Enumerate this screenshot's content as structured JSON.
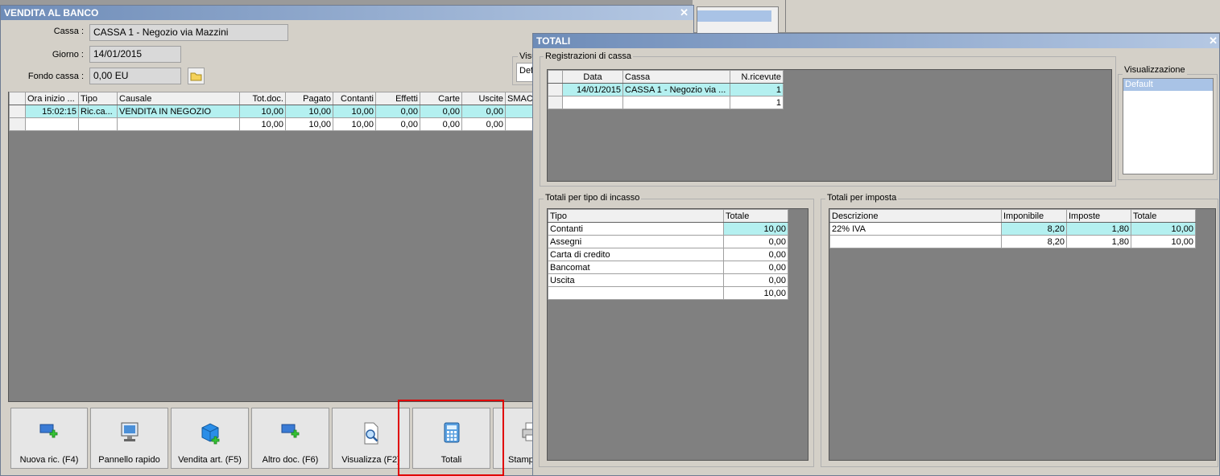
{
  "background": {
    "title_fragment": ""
  },
  "vendita": {
    "title": "VENDITA AL BANCO",
    "cassa_label": "Cassa :",
    "cassa_value": "CASSA 1 - Negozio via Mazzini",
    "giorno_label": "Giorno :",
    "giorno_value": "14/01/2015",
    "fondo_label": "Fondo cassa :",
    "fondo_value": "0,00 EU",
    "visu_label": "Visu",
    "visu_value": "Def",
    "columns": [
      "Ora inizio ...",
      "Tipo",
      "Causale",
      "Tot.doc.",
      "Pagato",
      "Contanti",
      "Effetti",
      "Carte",
      "Uscite",
      "SMAC"
    ],
    "rows": [
      [
        "15:02:15",
        "Ric.ca...",
        "VENDITA IN NEGOZIO",
        "10,00",
        "10,00",
        "10,00",
        "0,00",
        "0,00",
        "0,00",
        ""
      ],
      [
        "",
        "",
        "",
        "10,00",
        "10,00",
        "10,00",
        "0,00",
        "0,00",
        "0,00",
        ""
      ]
    ],
    "buttons": [
      "Nuova ric. (F4)",
      "Pannello rapido",
      "Vendita art. (F5)",
      "Altro doc. (F6)",
      "Visualizza (F2)",
      "Totali",
      "Stamp"
    ]
  },
  "totali": {
    "title": "TOTALI",
    "reg_group": "Registrazioni di cassa",
    "reg_columns": [
      "Data",
      "Cassa",
      "N.ricevute"
    ],
    "reg_rows": [
      [
        "14/01/2015",
        "CASSA 1 - Negozio via ...",
        "1"
      ],
      [
        "",
        "",
        "1"
      ]
    ],
    "visual_group": "Visualizzazione",
    "visual_items": [
      "Default"
    ],
    "tipo_group": "Totali per tipo di incasso",
    "tipo_columns": [
      "Tipo",
      "Totale"
    ],
    "tipo_rows": [
      [
        "Contanti",
        "10,00"
      ],
      [
        "Assegni",
        "0,00"
      ],
      [
        "Carta di credito",
        "0,00"
      ],
      [
        "Bancomat",
        "0,00"
      ],
      [
        "Uscita",
        "0,00"
      ],
      [
        "",
        "10,00"
      ]
    ],
    "imposta_group": "Totali per imposta",
    "imposta_columns": [
      "Descrizione",
      "Imponibile",
      "Imposte",
      "Totale"
    ],
    "imposta_rows": [
      [
        "22% IVA",
        "8,20",
        "1,80",
        "10,00"
      ],
      [
        "",
        "8,20",
        "1,80",
        "10,00"
      ]
    ]
  },
  "colors": {
    "title_start": "#6e8cb8",
    "title_end": "#b5c8e3",
    "selection": "#b4f0f0",
    "highlight_box": "#e00000"
  }
}
